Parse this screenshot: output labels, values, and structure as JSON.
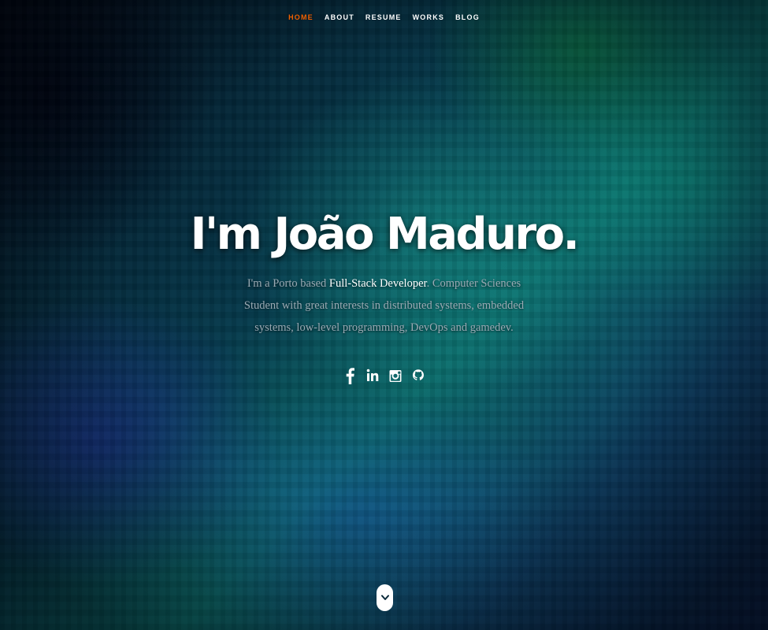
{
  "nav": {
    "items": [
      {
        "label": "Home",
        "active": true
      },
      {
        "label": "About",
        "active": false
      },
      {
        "label": "Resume",
        "active": false
      },
      {
        "label": "Works",
        "active": false
      },
      {
        "label": "Blog",
        "active": false
      }
    ],
    "active_color": "#f06000"
  },
  "hero": {
    "title": "I'm João Maduro.",
    "intro_prefix": "I'm a Porto based ",
    "intro_highlight": "Full-Stack Developer",
    "intro_suffix": ". Computer Sciences Student with great interests in distributed systems, embedded systems, low-level programming, DevOps and gamedev."
  },
  "social": {
    "icons": [
      "facebook-icon",
      "linkedin-icon",
      "instagram-icon",
      "github-icon"
    ]
  },
  "scroll_down": {
    "icon": "chevron-down-icon"
  }
}
